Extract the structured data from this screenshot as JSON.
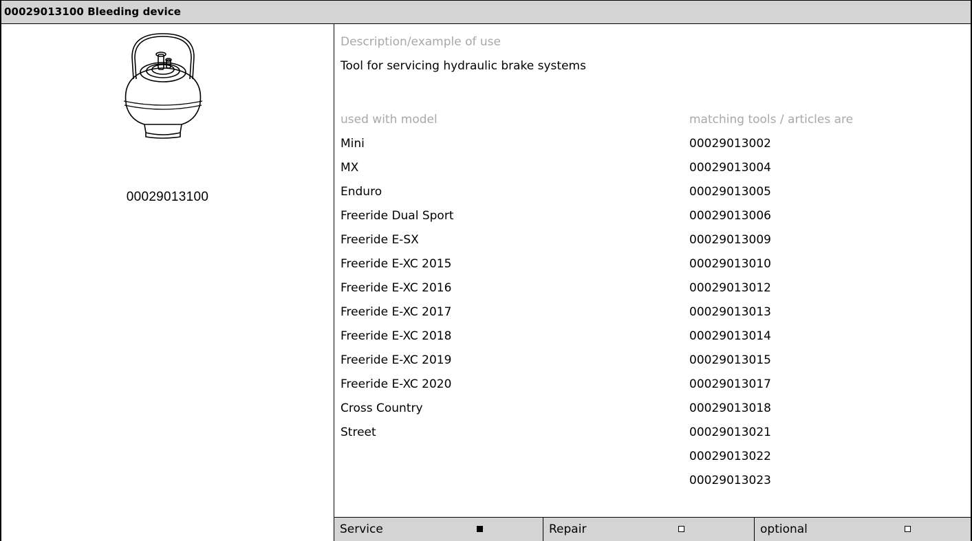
{
  "header": {
    "title": "00029013100 Bleeding device"
  },
  "image": {
    "icon": "bleeding-device-icon",
    "caption": "00029013100"
  },
  "description": {
    "label": "Description/example of use",
    "text": "Tool for servicing hydraulic brake systems"
  },
  "models": {
    "label": "used with model",
    "items": [
      "Mini",
      "MX",
      "Enduro",
      "Freeride Dual Sport",
      "Freeride E-SX",
      "Freeride E-XC 2015",
      "Freeride E-XC 2016",
      "Freeride E-XC 2017",
      "Freeride E-XC 2018",
      "Freeride E-XC 2019",
      "Freeride E-XC 2020",
      "Cross Country",
      "Street"
    ]
  },
  "tools": {
    "label": "matching tools / articles are",
    "items": [
      "00029013002",
      "00029013004",
      "00029013005",
      "00029013006",
      "00029013009",
      "00029013010",
      "00029013012",
      "00029013013",
      "00029013014",
      "00029013015",
      "00029013017",
      "00029013018",
      "00029013021",
      "00029013022",
      "00029013023"
    ]
  },
  "footer": {
    "service": {
      "label": "Service",
      "checked": true
    },
    "repair": {
      "label": "Repair",
      "checked": false
    },
    "optional": {
      "label": "optional",
      "checked": false
    }
  }
}
